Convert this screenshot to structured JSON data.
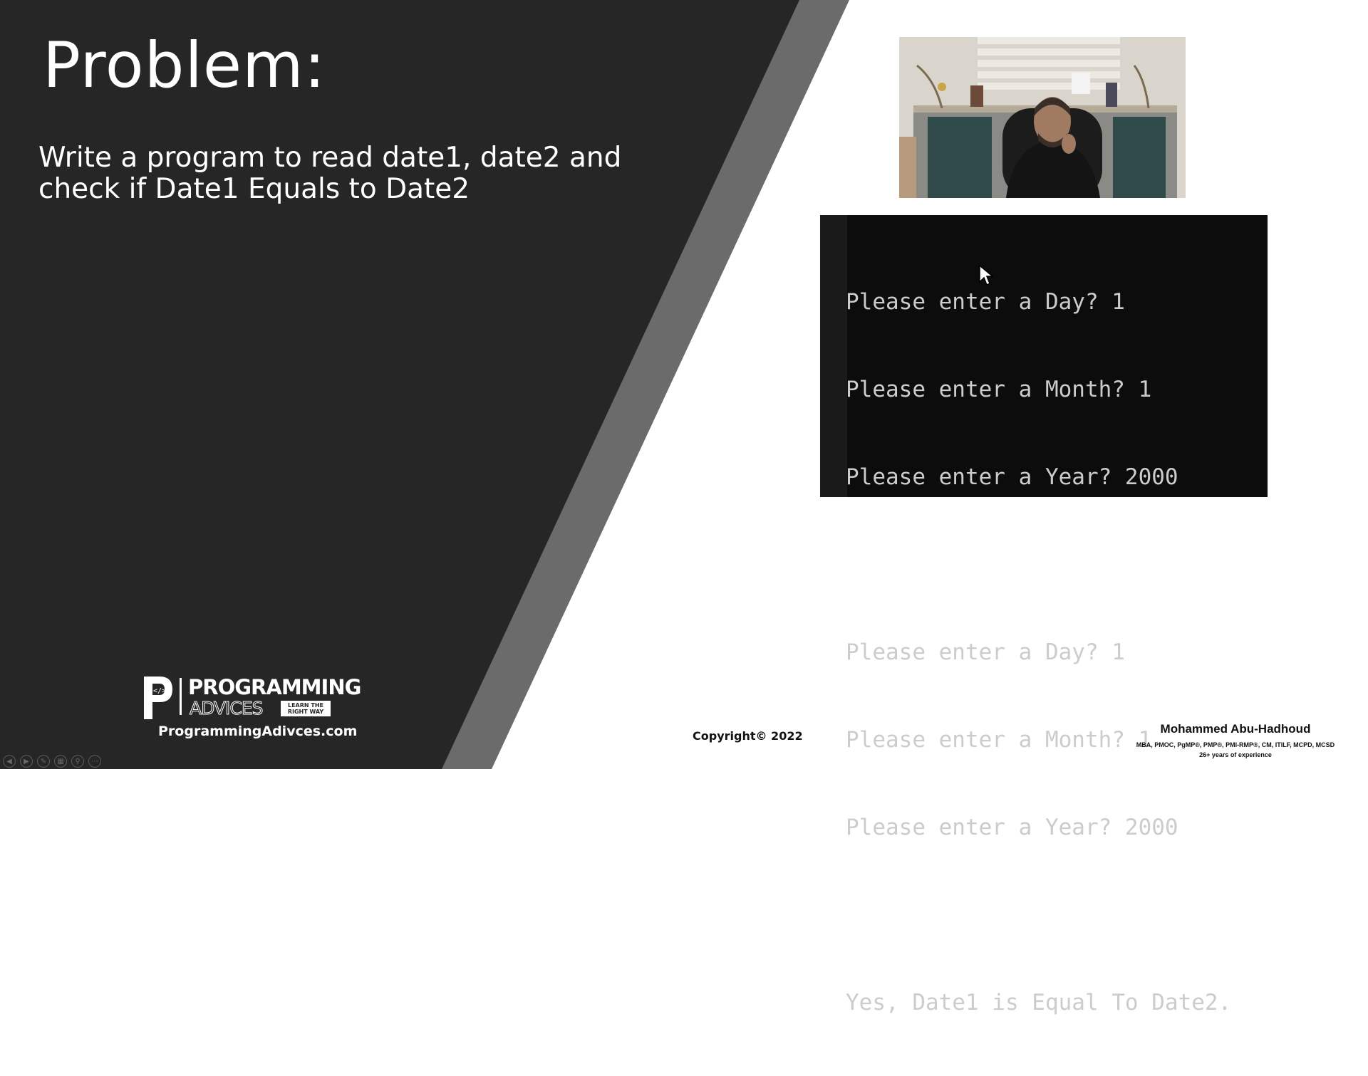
{
  "slide": {
    "title": "Problem:",
    "problem_lines": [
      "Write a program to read date1, date2 and",
      "check if Date1 Equals to Date2"
    ]
  },
  "console": {
    "lines": [
      "Please enter a Day? 1",
      "Please enter a Month? 1",
      "Please enter a Year? 2000",
      "",
      "Please enter a Day? 1",
      "Please enter a Month? 1",
      "Please enter a Year? 2000",
      "",
      "Yes, Date1 is Equal To Date2."
    ]
  },
  "branding": {
    "logo_word1": "PROGRAMMING",
    "logo_word2": "ADVICES",
    "logo_tag_line1": "LEARN THE",
    "logo_tag_line2": "RIGHT WAY",
    "website": "ProgrammingAdivces.com"
  },
  "footer": {
    "copyright": "Copyright© 2022",
    "author_name": "Mohammed Abu-Hadhoud",
    "author_credentials": "MBA, PMOC, PgMP®, PMP®, PMI-RMP®, CM, ITILF, MCPD, MCSD",
    "author_experience": "26+ years of experience"
  },
  "icons": {
    "controls": [
      "previous-slide-icon",
      "next-slide-icon",
      "pen-icon",
      "slides-view-icon",
      "zoom-icon",
      "more-options-icon"
    ],
    "cursor": "mouse-cursor-icon"
  },
  "colors": {
    "dark_panel": "#262626",
    "diagonal_stripe": "#6b6b6b",
    "slide_background": "#ffffff",
    "console_background": "#0c0c0c",
    "console_text": "#cccccc"
  }
}
